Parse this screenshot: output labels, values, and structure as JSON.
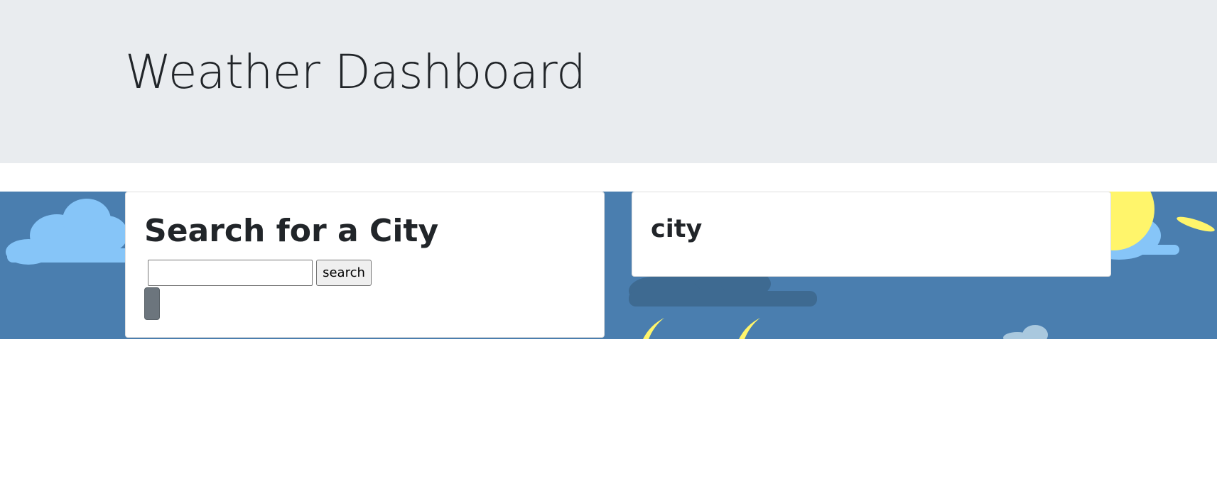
{
  "header": {
    "title": "Weather Dashboard"
  },
  "search": {
    "heading": "Search for a City",
    "input_value": "",
    "button_label": "search",
    "history_button_label": ""
  },
  "current": {
    "city_heading": "city"
  },
  "colors": {
    "jumbotron_bg": "#e9ecef",
    "sky_bg": "#4a7eaf",
    "history_button": "#6c757d"
  },
  "icons": [
    "cloud-icon",
    "sun-icon",
    "dark-cloud-icon",
    "moon-icon"
  ]
}
